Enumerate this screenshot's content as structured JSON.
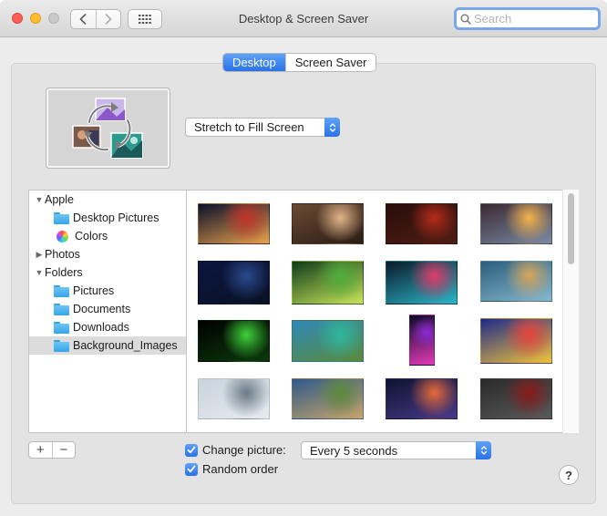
{
  "window": {
    "title": "Desktop & Screen Saver"
  },
  "toolbar": {
    "back_icon": "chevron-left-icon",
    "forward_icon": "chevron-right-icon",
    "grid_icon": "show-all-grid-icon",
    "search_placeholder": "Search",
    "search_value": ""
  },
  "tabs": [
    {
      "label": "Desktop",
      "selected": true
    },
    {
      "label": "Screen Saver",
      "selected": false
    }
  ],
  "fit_option": {
    "selected": "Stretch to Fill Screen"
  },
  "sources": {
    "apple": {
      "label": "Apple",
      "expanded": true
    },
    "desktop_pictures": "Desktop Pictures",
    "colors": "Colors",
    "photos": {
      "label": "Photos",
      "expanded": false
    },
    "folders": {
      "label": "Folders",
      "expanded": true
    },
    "pictures": "Pictures",
    "documents": "Documents",
    "downloads": "Downloads",
    "background_images": {
      "label": "Background_Images",
      "selected": true
    }
  },
  "thumbnails": [
    {
      "subject": "planets in space",
      "colors": [
        "#0a0f2b",
        "#c2342a",
        "#e9a24c"
      ]
    },
    {
      "subject": "winged figure",
      "colors": [
        "#6b4a34",
        "#e2b58a",
        "#2b1c14"
      ]
    },
    {
      "subject": "red dragon scene",
      "colors": [
        "#2a0d0a",
        "#b52b1a",
        "#4e1d14"
      ]
    },
    {
      "subject": "sunset over sea",
      "colors": [
        "#3b2a33",
        "#f5b24a",
        "#7a8aa3"
      ]
    },
    {
      "subject": "night sky lake",
      "colors": [
        "#0b1640",
        "#2a4a8c",
        "#0a1124"
      ]
    },
    {
      "subject": "forest waterfall",
      "colors": [
        "#0e3b1a",
        "#4fae3b",
        "#c9e55a"
      ]
    },
    {
      "subject": "colorful smoke",
      "colors": [
        "#0a1a2a",
        "#e03b6a",
        "#2bb7c9"
      ]
    },
    {
      "subject": "coastal cliffs",
      "colors": [
        "#2c5e7d",
        "#d6a65a",
        "#86b8cf"
      ]
    },
    {
      "subject": "green neon snake",
      "colors": [
        "#000000",
        "#3fd23a",
        "#0c3a0c"
      ]
    },
    {
      "subject": "mountain lake",
      "colors": [
        "#2e89b8",
        "#2fb89e",
        "#5a8a3a"
      ]
    },
    {
      "subject": "neon flower portrait",
      "colors": [
        "#0a0a2a",
        "#8a2ad6",
        "#e53ab8"
      ]
    },
    {
      "subject": "silhouette tree sunset",
      "colors": [
        "#1e2a8a",
        "#e8443a",
        "#f2c23a"
      ]
    },
    {
      "subject": "waterfall and canyon",
      "colors": [
        "#c9d3dc",
        "#6a7a86",
        "#e6eaee"
      ]
    },
    {
      "subject": "alpine valley",
      "colors": [
        "#2e5a8a",
        "#5c8a3a",
        "#c9a46a"
      ]
    },
    {
      "subject": "lanterns night sky",
      "colors": [
        "#0e1330",
        "#e66a3a",
        "#4a3a8a"
      ]
    },
    {
      "subject": "red tree stormy sky",
      "colors": [
        "#2a2a2a",
        "#8a1a1a",
        "#5a5a5a"
      ]
    }
  ],
  "bottom": {
    "add_label": "+",
    "remove_label": "−",
    "change_picture_label": "Change picture:",
    "change_picture_checked": true,
    "interval_selected": "Every 5 seconds",
    "random_order_label": "Random order",
    "random_order_checked": true,
    "help_label": "?"
  },
  "colors": {
    "accent": "#2f7ae5",
    "close": "#ff5f57",
    "minimize": "#febc2e"
  }
}
